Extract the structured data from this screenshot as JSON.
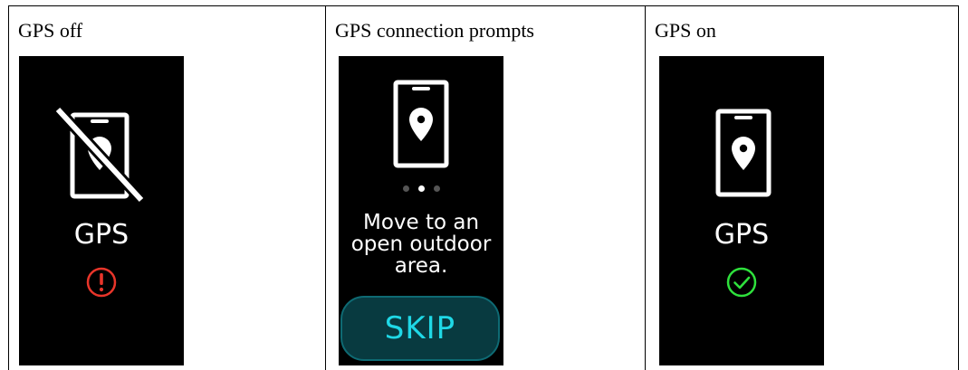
{
  "columns": [
    {
      "title": "GPS off",
      "label": "GPS",
      "icon": "gps-disabled-phone-icon",
      "status_icon": "alert-circle-icon",
      "status_color": "#e8352a"
    },
    {
      "title": "GPS connection prompts",
      "icon": "phone-location-icon",
      "pager": {
        "count": 3,
        "active_index": 1
      },
      "message": [
        "Move to an",
        "open outdoor",
        "area."
      ],
      "skip_label": "SKIP"
    },
    {
      "title": "GPS on",
      "label": "GPS",
      "icon": "phone-location-icon",
      "status_icon": "check-circle-icon",
      "status_color": "#2ee03c"
    }
  ],
  "colors": {
    "screen_bg": "#000000",
    "skip_bg": "#083a40",
    "skip_border": "#0e6a73",
    "skip_text": "#1fd8e6"
  }
}
